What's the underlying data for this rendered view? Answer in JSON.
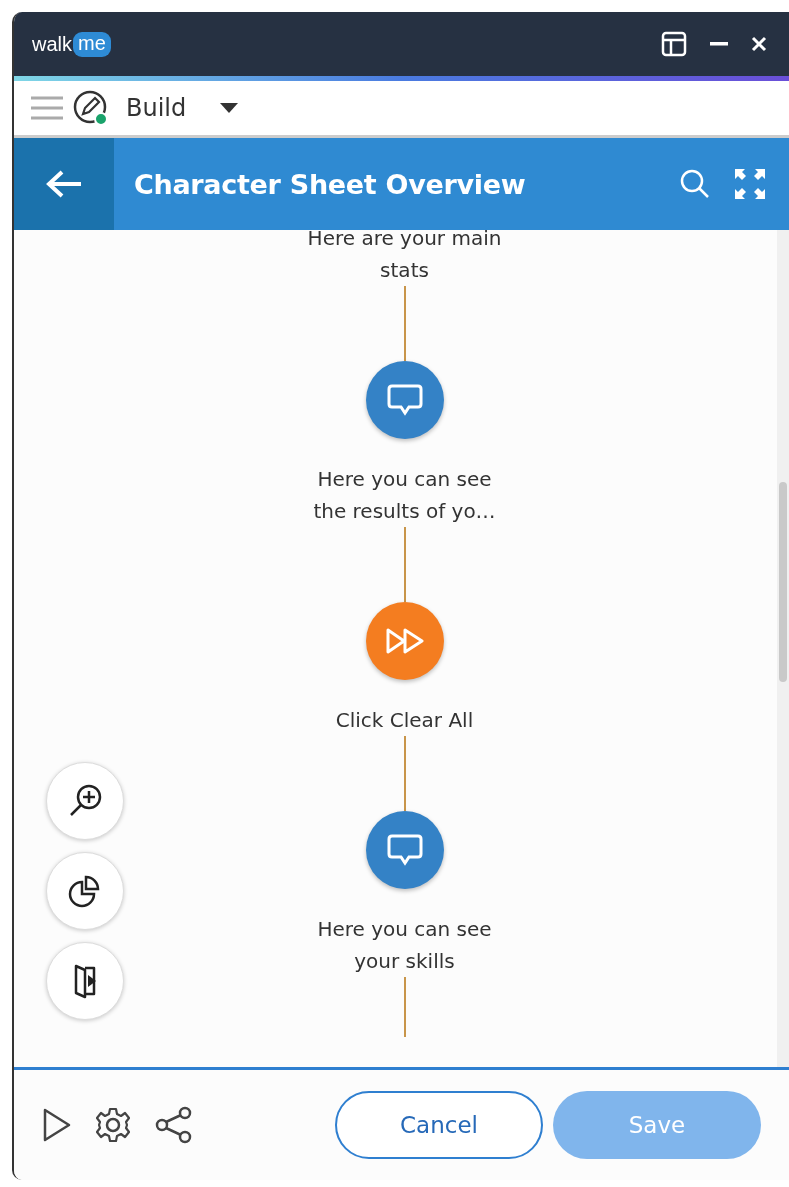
{
  "app": {
    "logo_left": "walk",
    "logo_right": "me"
  },
  "toolbar": {
    "mode": "Build"
  },
  "header": {
    "title": "Character Sheet Overview"
  },
  "flow": [
    {
      "kind": "label",
      "text": "Here are your main stats"
    },
    {
      "kind": "message"
    },
    {
      "kind": "label",
      "text": "Here you can see the results of yo…"
    },
    {
      "kind": "action"
    },
    {
      "kind": "label",
      "text": "Click Clear All"
    },
    {
      "kind": "message"
    },
    {
      "kind": "label",
      "text": "Here you can see your skills"
    }
  ],
  "footer": {
    "buttons": [
      {
        "label": "Cancel",
        "kind": "secondary",
        "disabled": false
      },
      {
        "label": "Save",
        "kind": "primary",
        "disabled": true
      }
    ]
  }
}
